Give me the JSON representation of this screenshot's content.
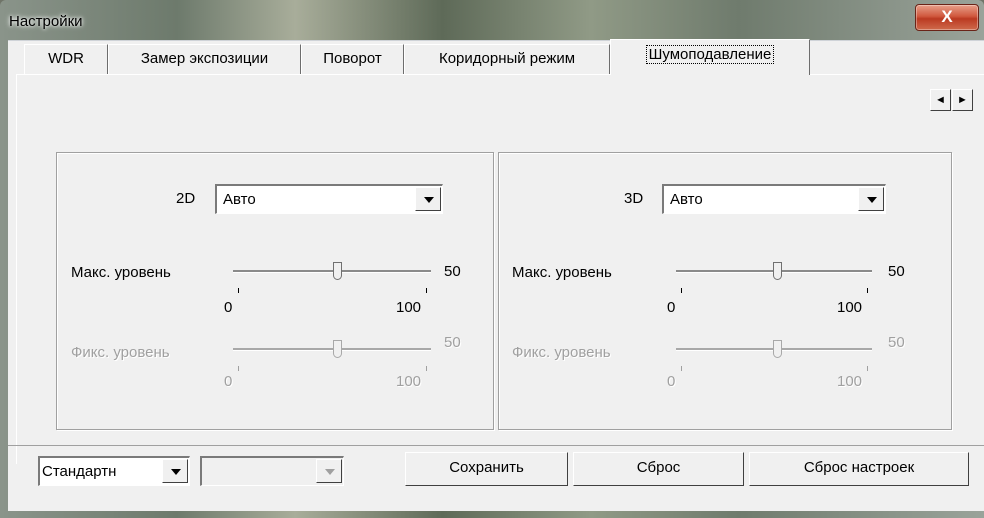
{
  "window": {
    "title": "Настройки",
    "close_label": "X"
  },
  "tabs": [
    {
      "label": "WDR"
    },
    {
      "label": "Замер экспозиции"
    },
    {
      "label": "Поворот"
    },
    {
      "label": "Коридорный режим"
    },
    {
      "label": "Шумоподавление",
      "active": true
    }
  ],
  "tab_scroll": {
    "left": "◄",
    "right": "►"
  },
  "panel_2d": {
    "mode_label": "2D",
    "mode_value": "Авто",
    "max_level": {
      "label": "Макс. уровень",
      "value": "50",
      "min": "0",
      "max": "100",
      "position": 0.5
    },
    "fixed_level": {
      "label": "Фикс. уровень",
      "value": "50",
      "min": "0",
      "max": "100",
      "position": 0.5,
      "enabled": false
    }
  },
  "panel_3d": {
    "mode_label": "3D",
    "mode_value": "Авто",
    "max_level": {
      "label": "Макс. уровень",
      "value": "50",
      "min": "0",
      "max": "100",
      "position": 0.5
    },
    "fixed_level": {
      "label": "Фикс. уровень",
      "value": "50",
      "min": "0",
      "max": "100",
      "position": 0.5,
      "enabled": false
    }
  },
  "footer": {
    "preset_value": "Стандартн",
    "secondary_value": "",
    "save_label": "Сохранить",
    "reset_label": "Сброс",
    "defaults_label": "Сброс настроек"
  }
}
